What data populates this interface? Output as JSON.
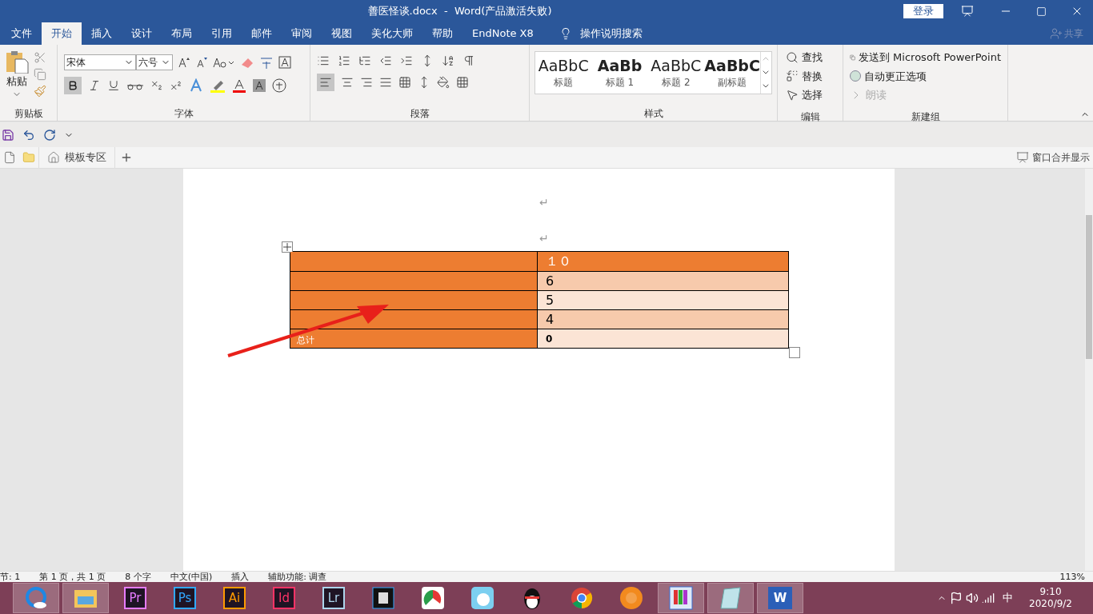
{
  "title_bar": {
    "document_title": "善医怪谈.docx  -  Word(产品激活失败)",
    "login_button": "登录"
  },
  "ribbon_tabs": [
    {
      "label": "文件",
      "selected": false
    },
    {
      "label": "开始",
      "selected": true
    },
    {
      "label": "插入",
      "selected": false
    },
    {
      "label": "设计",
      "selected": false
    },
    {
      "label": "布局",
      "selected": false
    },
    {
      "label": "引用",
      "selected": false
    },
    {
      "label": "邮件",
      "selected": false
    },
    {
      "label": "审阅",
      "selected": false
    },
    {
      "label": "视图",
      "selected": false
    },
    {
      "label": "美化大师",
      "selected": false
    },
    {
      "label": "帮助",
      "selected": false
    },
    {
      "label": "EndNote X8",
      "selected": false
    }
  ],
  "tell_me": "操作说明搜索",
  "share": "共享",
  "clipboard": {
    "paste": "粘贴",
    "label": "剪贴板"
  },
  "font": {
    "font_name": "宋体",
    "font_size": "六号",
    "label": "字体",
    "bold_on": true
  },
  "paragraph": {
    "label": "段落",
    "align_left_on": true
  },
  "styles": {
    "label": "样式",
    "items": [
      {
        "preview": "AaBbC",
        "name": "标题",
        "bold": false
      },
      {
        "preview": "AaBb",
        "name": "标题 1",
        "bold": true
      },
      {
        "preview": "AaBbC",
        "name": "标题 2",
        "bold": false
      },
      {
        "preview": "AaBbC",
        "name": "副标题",
        "bold": true
      }
    ]
  },
  "paragraph_marks": [
    "↵",
    "↵"
  ],
  "editing": {
    "label": "编辑",
    "find": "查找",
    "replace": "替换",
    "select": "选择"
  },
  "new_group": {
    "label": "新建组",
    "send_to": "发送到 Microsoft PowerPoint",
    "autocorrect": "自动更正选项",
    "read_aloud": "朗读"
  },
  "doc_tabs": {
    "template": "模板专区",
    "merge": "窗口合并显示"
  },
  "table": {
    "rows": [
      {
        "label": "",
        "value": "１０",
        "color": "#ed7d31",
        "bold": false
      },
      {
        "label": "",
        "value": "6",
        "color": "#f7caac",
        "bold": false
      },
      {
        "label": "",
        "value": "5",
        "color": "#fbe4d5",
        "bold": false
      },
      {
        "label": "",
        "value": "4",
        "color": "#f7caac",
        "bold": false
      },
      {
        "label": "总计",
        "value": "0",
        "color": "#fbe4d5",
        "bold": true
      }
    ]
  },
  "status_bar": {
    "items": [
      "节: 1",
      "第 1 页，共 1 页",
      "8 个字",
      "中文(中国)",
      "插入"
    ],
    "accessibility": "辅助功能: 调查",
    "zoom": "113%"
  },
  "taskbar": {
    "apps": [
      {
        "kind": "browser",
        "selected": true
      },
      {
        "kind": "folder",
        "selected": true
      },
      {
        "kind": "adobe",
        "label": "Pr",
        "color": "#e77cff",
        "selected": false
      },
      {
        "kind": "adobe",
        "label": "Ps",
        "color": "#31a8ff",
        "selected": false
      },
      {
        "kind": "adobe",
        "label": "Ai",
        "color": "#ff9a00",
        "selected": false
      },
      {
        "kind": "adobe",
        "label": "Id",
        "color": "#ff3366",
        "selected": false
      },
      {
        "kind": "adobe",
        "label": "Lr",
        "color": "#add5ec",
        "selected": false
      },
      {
        "kind": "film",
        "selected": false
      },
      {
        "kind": "chart",
        "selected": false
      },
      {
        "kind": "rabbit",
        "selected": false
      },
      {
        "kind": "penguin",
        "selected": false
      },
      {
        "kind": "chrome",
        "selected": false
      },
      {
        "kind": "tiger",
        "selected": false
      },
      {
        "kind": "books",
        "selected": true
      },
      {
        "kind": "notepad",
        "selected": true
      },
      {
        "kind": "word",
        "label": "W",
        "selected": true
      }
    ],
    "ime": "中",
    "time": "9:10",
    "date": "2020/9/2"
  }
}
